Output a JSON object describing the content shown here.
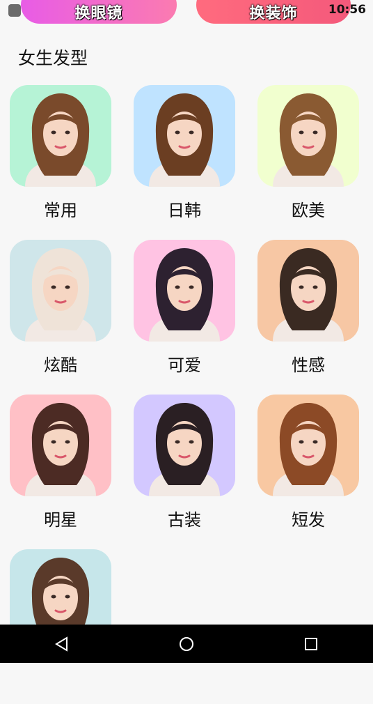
{
  "status_bar": {
    "time": "10:56"
  },
  "top_buttons": [
    {
      "label": "换眼镜"
    },
    {
      "label": "换装饰"
    }
  ],
  "section": {
    "title": "女生发型"
  },
  "hairstyles": [
    {
      "label": "常用",
      "bg": "#b6f3d6",
      "hair": "#7a4a2b"
    },
    {
      "label": "日韩",
      "bg": "#bfe3ff",
      "hair": "#6b3e22"
    },
    {
      "label": "欧美",
      "bg": "#f1ffcf",
      "hair": "#8a5a32"
    },
    {
      "label": "炫酷",
      "bg": "#cfe6ea",
      "hair": "#efe3d8"
    },
    {
      "label": "可爱",
      "bg": "#ffc3e3",
      "hair": "#2d2130"
    },
    {
      "label": "性感",
      "bg": "#f7c7a4",
      "hair": "#3a2a22"
    },
    {
      "label": "明星",
      "bg": "#ffc0c6",
      "hair": "#4c2b24"
    },
    {
      "label": "古装",
      "bg": "#d3c8ff",
      "hair": "#2a1f23"
    },
    {
      "label": "短发",
      "bg": "#f8c8a2",
      "hair": "#8c4a26"
    },
    {
      "label": "",
      "bg": "#c6e6ea",
      "hair": "#5a3a2a"
    }
  ],
  "nav": {
    "back": "back-icon",
    "home": "home-icon",
    "recents": "recents-icon"
  }
}
